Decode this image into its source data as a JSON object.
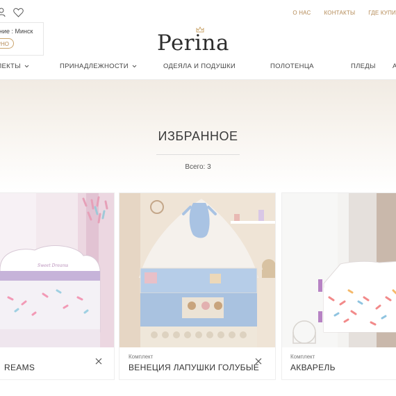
{
  "header": {
    "toplinks": [
      "О НАС",
      "КОНТАКТЫ",
      "ГДЕ КУПИ"
    ],
    "region": {
      "text": "ение : Минск",
      "button": "ЕРНО"
    },
    "logo": "Perina"
  },
  "nav": {
    "items": [
      "ЛЕКТЫ",
      "ПРИНАДЛЕЖНОСТИ",
      "ОДЕЯЛА И ПОДУШКИ",
      "ПОЛОТЕНЦА",
      "ПЛЕДЫ",
      "А"
    ]
  },
  "page": {
    "title": "ИЗБРАННОЕ",
    "count": "Всего: 3"
  },
  "cards": [
    {
      "category": "",
      "name": "REAMS"
    },
    {
      "category": "Комплект",
      "name": "ВЕНЕЦИЯ ЛАПУШКИ ГОЛУБЫЕ"
    },
    {
      "category": "Комплект",
      "name": "АКВАРЕЛЬ"
    }
  ],
  "colors": {
    "accent": "#b48a56",
    "hero": "#f1ebe3"
  },
  "icons": [
    "user-icon",
    "heart-icon",
    "chevron-down-icon",
    "close-icon",
    "crown-icon"
  ]
}
